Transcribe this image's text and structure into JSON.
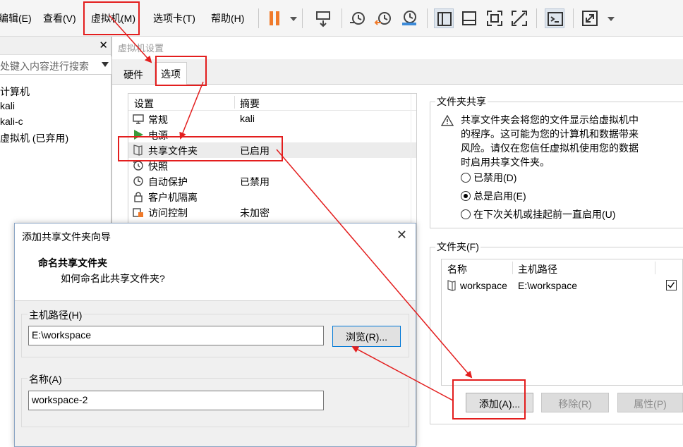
{
  "menubar": {
    "items": [
      "编辑(E)",
      "查看(V)",
      "虚拟机(M)",
      "选项卡(T)",
      "帮助(H)"
    ]
  },
  "library": {
    "search_placeholder": "处键入内容进行搜索",
    "items": [
      "计算机",
      "kali",
      "kali-c",
      "虚拟机 (已弃用)"
    ]
  },
  "settings": {
    "title": "虚拟机设置",
    "tabs": [
      "硬件",
      "选项"
    ],
    "active_tab": "选项",
    "list_headers": [
      "设置",
      "摘要"
    ],
    "rows": [
      {
        "name": "常规",
        "summary": "kali",
        "icon": "monitor-icon"
      },
      {
        "name": "电源",
        "summary": "",
        "icon": "power-play-icon"
      },
      {
        "name": "共享文件夹",
        "summary": "已启用",
        "icon": "shared-folder-icon",
        "selected": true
      },
      {
        "name": "快照",
        "summary": "",
        "icon": "snapshot-icon"
      },
      {
        "name": "自动保护",
        "summary": "已禁用",
        "icon": "autoprotect-icon"
      },
      {
        "name": "客户机隔离",
        "summary": "",
        "icon": "lock-icon"
      },
      {
        "name": "访问控制",
        "summary": "未加密",
        "icon": "access-control-icon"
      }
    ],
    "folder_sharing": {
      "title": "文件夹共享",
      "warning_lines": [
        "共享文件夹会将您的文件显示给虚拟机中",
        "的程序。这可能为您的计算机和数据带来",
        "风险。请仅在您信任虚拟机使用您的数据",
        "时启用共享文件夹。"
      ],
      "options": [
        "已禁用(D)",
        "总是启用(E)",
        "在下次关机或挂起前一直启用(U)"
      ],
      "selected_option": "总是启用(E)"
    },
    "folders": {
      "title": "文件夹(F)",
      "headers": [
        "名称",
        "主机路径"
      ],
      "rows": [
        {
          "name": "workspace",
          "path": "E:\\workspace",
          "enabled": true
        }
      ],
      "add_label": "添加(A)...",
      "remove_label": "移除(R)",
      "props_label": "属性(P)"
    }
  },
  "wizard": {
    "title": "添加共享文件夹向导",
    "close_glyph": "✕",
    "heading": "命名共享文件夹",
    "subheading": "如何命名此共享文件夹?",
    "host_path_label": "主机路径(H)",
    "host_path_value": "E:\\workspace",
    "browse_label": "浏览(R)...",
    "name_label": "名称(A)",
    "name_value": "workspace-2"
  },
  "colors": {
    "accent_orange": "#f07a2a",
    "annotation_red": "#e31e1e",
    "focus_blue": "#0078d7"
  }
}
